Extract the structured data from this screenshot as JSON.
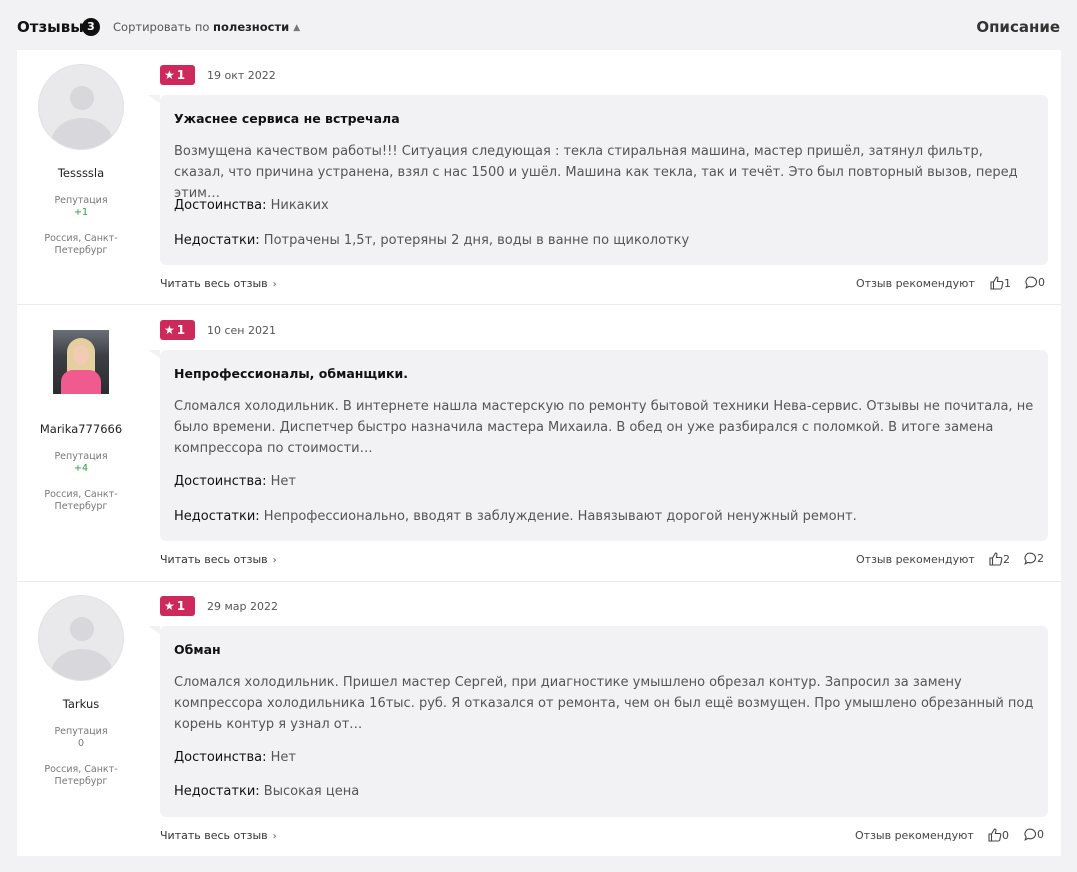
{
  "header": {
    "title": "Отзывы",
    "count": "3",
    "sort_prefix": "Сортировать по",
    "sort_value": "полезности",
    "description_link": "Описание"
  },
  "common": {
    "reputation_label": "Репутация",
    "read_full": "Читать весь отзыв",
    "recommend_label": "Отзыв рекомендуют",
    "pros_label": "Достоинства:",
    "cons_label": "Недостатки:"
  },
  "reviews": [
    {
      "username": "Tessssla",
      "reputation": "+1",
      "location": "Россия, Санкт-Петербург",
      "rating": "1",
      "date": "19 окт 2022",
      "title": "Ужаснее сервиса не встречала",
      "text": "Возмущена качеством работы!!! Ситуация следующая : текла стиральная машина, мастер пришёл, затянул фильтр, сказал, что причина устранена, взял с нас 1500 и ушёл. Машина как текла, так и течёт. Это был повторный вызов, перед этим…",
      "pros": "Никаких",
      "cons": "Потрачены 1,5т, ротеряны 2 дня, воды в ванне по щиколотку",
      "likes": "1",
      "comments": "0"
    },
    {
      "username": "Marika777666",
      "reputation": "+4",
      "location": "Россия, Санкт-Петербург",
      "rating": "1",
      "date": "10 сен 2021",
      "title": "Непрофессионалы, обманщики.",
      "text": "Сломался холодильник. В интернете нашла мастерскую по ремонту бытовой техники Нева-сервис. Отзывы не почитала, не было времени. Диспетчер быстро назначила мастера Михаила. В обед он уже разбирался с поломкой. В итоге замена компрессора по стоимости…",
      "pros": "Нет",
      "cons": "Непрофессионально, вводят в заблуждение. Навязывают дорогой ненужный ремонт.",
      "likes": "2",
      "comments": "2"
    },
    {
      "username": "Tarkus",
      "reputation": "0",
      "location": "Россия, Санкт-Петербург",
      "rating": "1",
      "date": "29 мар 2022",
      "title": "Обман",
      "text": "Сломался холодильник. Пришел мастер Сергей, при диагностике умышлено обрезал контур. Запросил за замену компрессора холодильника 16тыс. руб. Я отказался от ремонта, чем он был ещё возмущен. Про умышлено обрезанный под корень контур я узнал от…",
      "pros": "Нет",
      "cons": "Высокая цена",
      "likes": "0",
      "comments": "0"
    }
  ],
  "colors": {
    "badge": "#cd2a5b",
    "positive_reputation": "#2a9d3a",
    "background": "#f2f2f4"
  },
  "icons": {
    "rating": "star-icon",
    "like": "thumb-up-icon",
    "comment": "comment-bubble-icon",
    "sort": "sort-arrows-icon",
    "more": "chevron-right-icon"
  }
}
